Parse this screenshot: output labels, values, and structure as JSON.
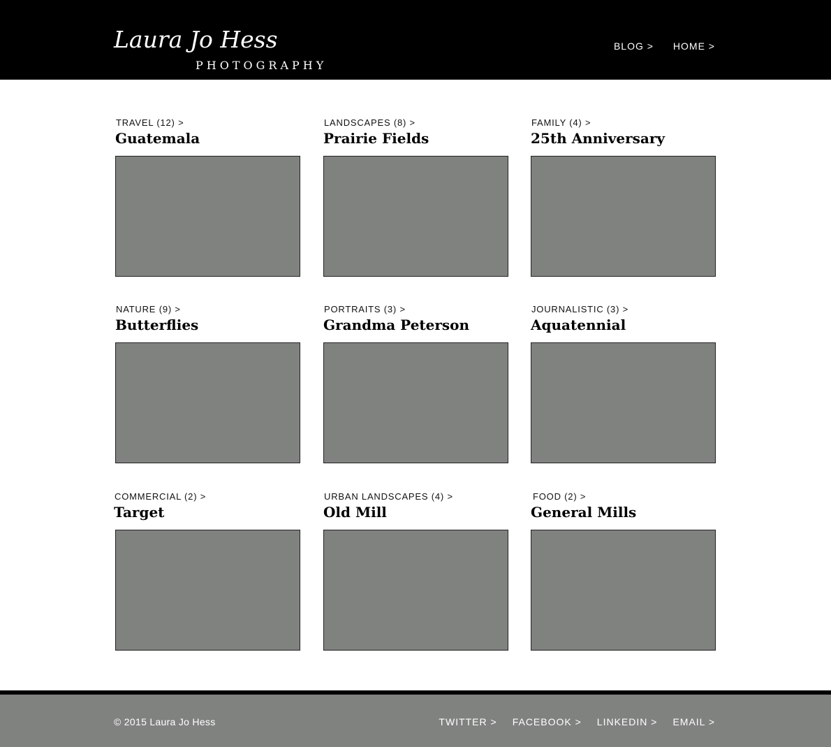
{
  "header": {
    "logo_name": "Laura Jo Hess",
    "logo_sub": "PHOTOGRAPHY",
    "nav": [
      {
        "label": "BLOG  >"
      },
      {
        "label": "HOME  >"
      }
    ]
  },
  "gallery": [
    {
      "category": "TRAVEL (12) >",
      "title": "Guatemala"
    },
    {
      "category": "LANDSCAPES (8) >",
      "title": "Prairie Fields"
    },
    {
      "category": "FAMILY (4) >",
      "title": "25th Anniversary"
    },
    {
      "category": "NATURE (9) >",
      "title": "Butterflies"
    },
    {
      "category": "PORTRAITS (3) >",
      "title": "Grandma Peterson"
    },
    {
      "category": "JOURNALISTIC (3) >",
      "title": "Aquatennial"
    },
    {
      "category": "COMMERCIAL (2) >",
      "title": "Target"
    },
    {
      "category": "URBAN LANDSCAPES (4) >",
      "title": "Old Mill"
    },
    {
      "category": "FOOD (2) >",
      "title": "General Mills"
    }
  ],
  "footer": {
    "copyright": "© 2015 Laura Jo Hess",
    "social": [
      {
        "label": "TWITTER  >"
      },
      {
        "label": "FACEBOOK  >"
      },
      {
        "label": "LINKEDIN  >"
      },
      {
        "label": "EMAIL >"
      }
    ]
  },
  "colors": {
    "header_bg": "#000000",
    "thumb_placeholder": "#808280",
    "footer_bg": "#808280"
  }
}
